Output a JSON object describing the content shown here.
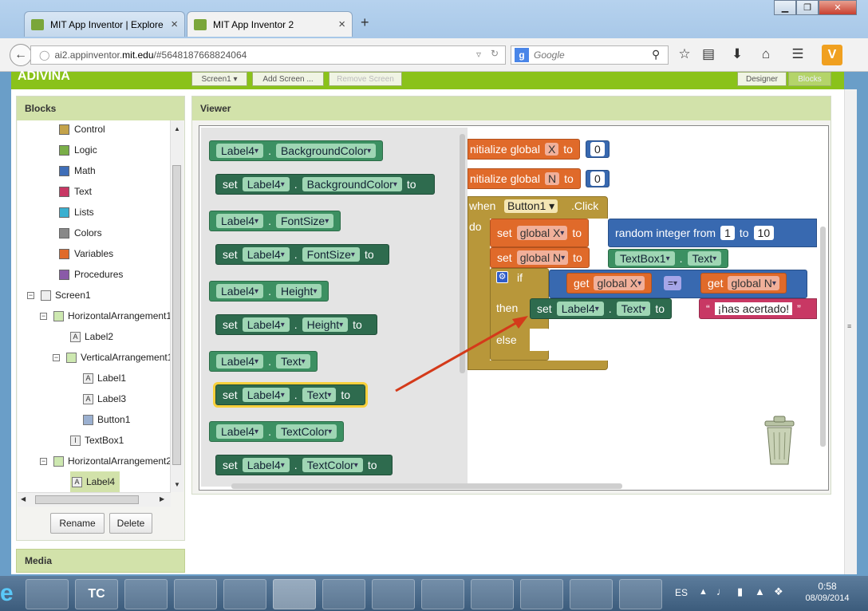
{
  "browser": {
    "tabs": [
      {
        "title": "MIT App Inventor | Explore ..."
      },
      {
        "title": "MIT App Inventor 2"
      }
    ],
    "new_tab": "+",
    "close_glyph": "×",
    "window_controls": {
      "minimize": "▁",
      "maximize": "❐",
      "close": "✕"
    },
    "url_prefix": "ai2.appinventor.",
    "url_domain": "mit.edu",
    "url_suffix": "/#5648187668824064",
    "search_engine": "g",
    "search_placeholder": "Google"
  },
  "app": {
    "title": "ADIVINA",
    "screen_button": "Screen1 ▾",
    "add_screen": "Add Screen ...",
    "remove_screen": "Remove Screen",
    "designer": "Designer",
    "blocks": "Blocks"
  },
  "blocks_panel": {
    "header": "Blocks",
    "builtin": [
      {
        "label": "Control",
        "color": "#c4a34a"
      },
      {
        "label": "Logic",
        "color": "#7aae48"
      },
      {
        "label": "Math",
        "color": "#3f6eb8"
      },
      {
        "label": "Text",
        "color": "#c83864"
      },
      {
        "label": "Lists",
        "color": "#3ab0d0"
      },
      {
        "label": "Colors",
        "color": "#888888"
      },
      {
        "label": "Variables",
        "color": "#e06a2a"
      },
      {
        "label": "Procedures",
        "color": "#8a5aa8"
      }
    ],
    "components": [
      {
        "label": "Screen1",
        "toggle": "−"
      },
      {
        "label": "HorizontalArrangement1",
        "toggle": "−"
      },
      {
        "label": "Label2",
        "icon": "A"
      },
      {
        "label": "VerticalArrangement1",
        "toggle": "−"
      },
      {
        "label": "Label1",
        "icon": "A"
      },
      {
        "label": "Label3",
        "icon": "A"
      },
      {
        "label": "Button1",
        "icon": ""
      },
      {
        "label": "TextBox1",
        "icon": "I"
      },
      {
        "label": "HorizontalArrangement2",
        "toggle": "−"
      },
      {
        "label": "Label4",
        "icon": "A"
      }
    ],
    "rename": "Rename",
    "delete": "Delete"
  },
  "media_panel": {
    "header": "Media"
  },
  "viewer": {
    "header": "Viewer",
    "flyout": [
      {
        "kind": "get",
        "component": "Label4",
        "property": "BackgroundColor"
      },
      {
        "kind": "set",
        "component": "Label4",
        "property": "BackgroundColor"
      },
      {
        "kind": "get",
        "component": "Label4",
        "property": "FontSize"
      },
      {
        "kind": "set",
        "component": "Label4",
        "property": "FontSize"
      },
      {
        "kind": "get",
        "component": "Label4",
        "property": "Height"
      },
      {
        "kind": "set",
        "component": "Label4",
        "property": "Height"
      },
      {
        "kind": "get",
        "component": "Label4",
        "property": "Text"
      },
      {
        "kind": "set",
        "component": "Label4",
        "property": "Text"
      },
      {
        "kind": "get",
        "component": "Label4",
        "property": "TextColor"
      },
      {
        "kind": "set",
        "component": "Label4",
        "property": "TextColor"
      }
    ],
    "kw_set": "set",
    "kw_to": "to",
    "dot": ".",
    "workspace": {
      "init_label": "nitialize global",
      "init1_var": "X",
      "init1_val": "0",
      "init2_var": "N",
      "init2_val": "0",
      "when_kw": "when",
      "when_component": "Button1",
      "when_event": ".Click",
      "do_kw": "do",
      "set_global_x": "global X",
      "random_label": "random integer  from",
      "random_from": "1",
      "random_to_kw": "to",
      "random_to": "10",
      "set_global_n": "global N",
      "textbox_component": "TextBox1",
      "textbox_property": "Text",
      "if_kw": "if",
      "get_kw": "get",
      "cmp_left": "global X",
      "cmp_op": "=",
      "cmp_right": "global N",
      "then_kw": "then",
      "then_component": "Label4",
      "then_property": "Text",
      "string_quote": "“",
      "string_value": "¡has acertado!",
      "string_end": "”",
      "else_kw": "else"
    }
  },
  "taskbar": {
    "items": [
      "e",
      "",
      "TC",
      "",
      "",
      "",
      "",
      "",
      "",
      "",
      "",
      "",
      "",
      ""
    ],
    "lang": "ES",
    "time": "0:58",
    "date": "08/09/2014"
  }
}
